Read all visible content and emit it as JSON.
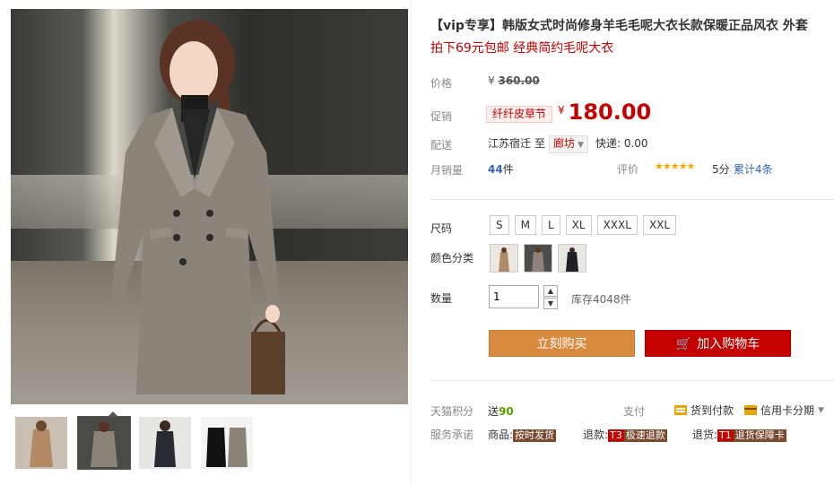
{
  "product": {
    "title": "【vip专享】韩版女式时尚修身羊毛毛呢大衣长款保暖正品风衣 外套",
    "subtitle": "拍下69元包邮 经典简约毛呢大衣"
  },
  "price_section": {
    "price_label": "价格",
    "original_currency": "¥",
    "original_price": "360.00",
    "promo_label": "促销",
    "promo_tag": "纤纤皮草节",
    "promo_currency": "¥",
    "promo_price": "180.00"
  },
  "shipping": {
    "label": "配送",
    "from": "江苏宿迁",
    "to_word": "至",
    "destination": "廊坊",
    "fee": "快递: 0.00"
  },
  "sales": {
    "label": "月销量",
    "count": "44",
    "unit": "件",
    "rating_label": "评价",
    "stars": "★★★★★",
    "score": "5分",
    "reviews": "累计4条"
  },
  "options": {
    "size_label": "尺码",
    "sizes": [
      "S",
      "M",
      "L",
      "XL",
      "XXXL",
      "XXL"
    ],
    "color_label": "颜色分类",
    "quantity_label": "数量",
    "quantity_value": "1",
    "stock": "库存4048件"
  },
  "actions": {
    "buy_now": "立刻购买",
    "add_to_cart": "加入购物车"
  },
  "extra": {
    "points_label": "天猫积分",
    "points_prefix": "送",
    "points_value": "90",
    "pay_label": "支付",
    "pay_cod": "货到付款",
    "pay_credit": "信用卡分期",
    "promise_label": "服务承诺",
    "promise_goods_prefix": "商品:",
    "promise_goods_tag": "按时发货",
    "promise_refund_prefix": "退款:",
    "promise_refund_code": "T3",
    "promise_refund_tag": "极速退款",
    "promise_return_prefix": "退货:",
    "promise_return_code": "T1",
    "promise_return_tag": "退货保障卡"
  },
  "colors": {
    "accent_red": "#c40000",
    "buy_orange": "#d98a3e",
    "star_gold": "#f0a900"
  }
}
